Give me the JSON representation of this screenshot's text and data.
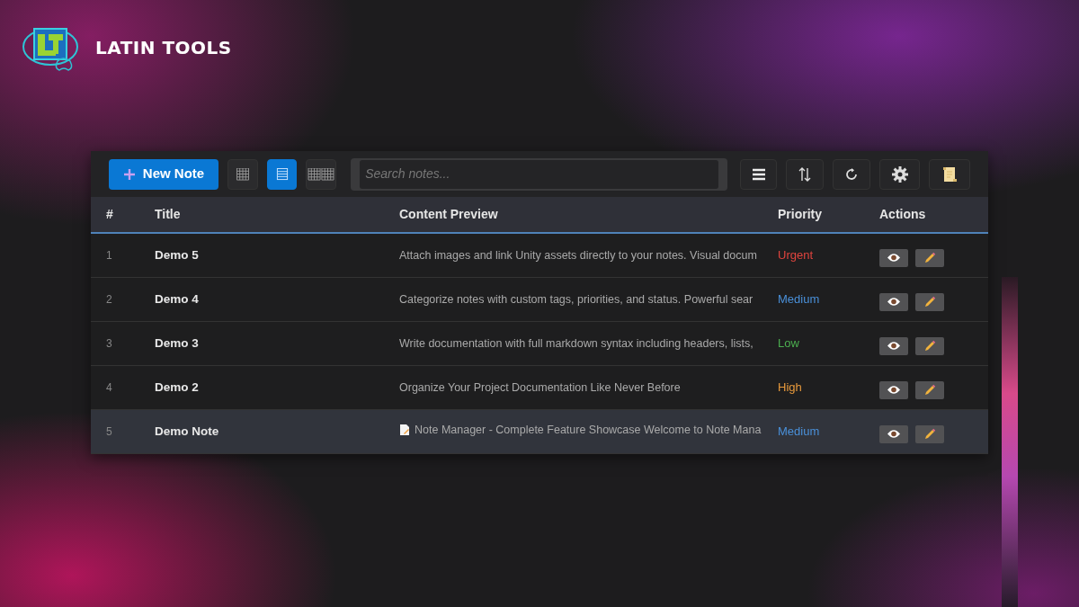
{
  "brand": {
    "name": "LATIN TOOLS"
  },
  "toolbar": {
    "new_button": "New Note",
    "views": [
      {
        "kind": "grid",
        "selected": false
      },
      {
        "kind": "list",
        "selected": true
      },
      {
        "kind": "wide",
        "selected": false
      }
    ],
    "search": {
      "placeholder": "Search notes..."
    },
    "tools": [
      {
        "kind": "menu"
      },
      {
        "kind": "sort"
      },
      {
        "kind": "refresh"
      },
      {
        "kind": "settings"
      },
      {
        "kind": "scroll"
      }
    ]
  },
  "table": {
    "columns": [
      "#",
      "Title",
      "Content Preview",
      "Priority",
      "Actions"
    ],
    "rows": [
      {
        "number": "1",
        "title": "Demo 5",
        "preview": "Attach images and link Unity assets directly to your notes. Visual docum",
        "priority": "Urgent",
        "color": "#e0443e",
        "selected": false
      },
      {
        "number": "2",
        "title": "Demo 4",
        "preview": "Categorize notes with custom tags, priorities, and status. Powerful sear",
        "priority": "Medium",
        "color": "#4a90d9",
        "selected": false
      },
      {
        "number": "3",
        "title": "Demo 3",
        "preview": "Write documentation with full markdown syntax including headers, lists,",
        "priority": "Low",
        "color": "#4caf50",
        "selected": false
      },
      {
        "number": "4",
        "title": "Demo 2",
        "preview": "Organize Your Project Documentation Like Never Before",
        "priority": "High",
        "color": "#e89a3c",
        "selected": false
      },
      {
        "number": "5",
        "title": "Demo Note",
        "preview": "Note Manager - Complete Feature Showcase Welcome to Note Mana",
        "preview_icon": true,
        "priority": "Medium",
        "color": "#4a90d9",
        "selected": true
      }
    ]
  }
}
